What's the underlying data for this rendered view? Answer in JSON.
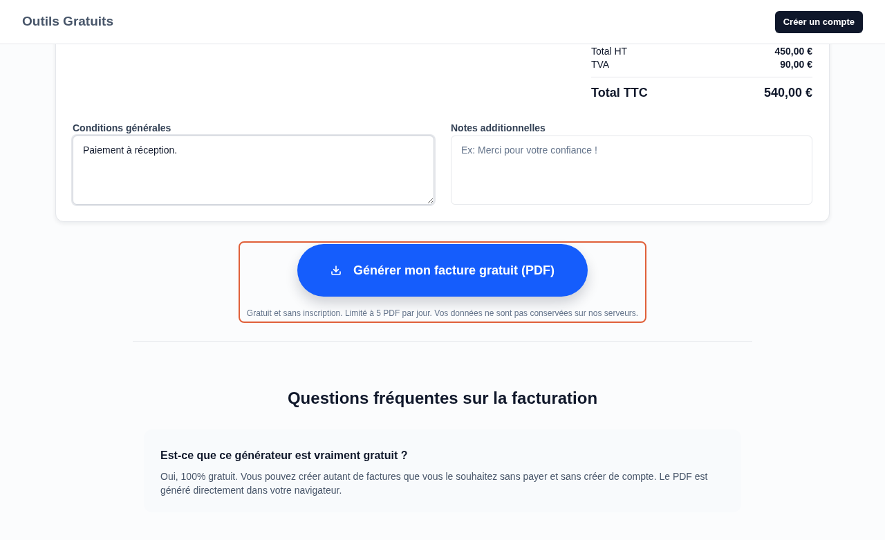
{
  "header": {
    "brand": "Outils Gratuits",
    "signup_button": "Créer un compte"
  },
  "totals": [
    {
      "kind": "line",
      "label": "Total HT",
      "value": "450,00 €"
    },
    {
      "kind": "line",
      "label": "TVA",
      "value": "90,00 €"
    },
    {
      "kind": "grand",
      "label": "Total TTC",
      "value": "540,00 €"
    }
  ],
  "fields": [
    {
      "label": "Conditions générales",
      "value": "Paiement à réception.",
      "focused": true
    },
    {
      "label": "Notes additionnelles",
      "placeholder": "Ex: Merci pour votre confiance !",
      "focused": false
    }
  ],
  "generate": {
    "button": "Générer mon facture gratuit (PDF)",
    "note": "Gratuit et sans inscription. Limité à 5 PDF par jour. Vos données ne sont pas conservées sur nos serveurs.",
    "highlighted": true
  },
  "faq": {
    "title": "Questions fréquentes sur la facturation",
    "items": [
      {
        "question": "Est-ce que ce générateur est vraiment gratuit ?",
        "answer": "Oui, 100% gratuit. Vous pouvez créer autant de factures que vous le souhaitez sans payer et sans créer de compte. Le PDF est généré directement dans votre navigateur."
      }
    ]
  }
}
